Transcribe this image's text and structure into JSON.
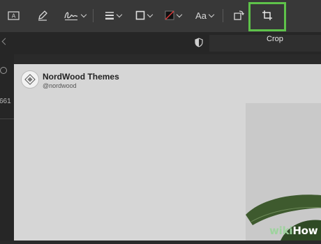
{
  "toolbar": {
    "tools": [
      {
        "icon": "text-box-icon"
      },
      {
        "icon": "pen-icon"
      },
      {
        "icon": "signature-icon"
      },
      {
        "icon": "line-style-icon"
      },
      {
        "icon": "border-color-icon"
      },
      {
        "icon": "fill-color-icon"
      },
      {
        "icon": "text-style-icon",
        "label": "Aa"
      },
      {
        "icon": "rotate-icon"
      },
      {
        "icon": "crop-icon"
      }
    ],
    "crop_tooltip": "Crop",
    "highlight_color": "#5ec24a"
  },
  "sidebar": {
    "partial_count": "661"
  },
  "post": {
    "author_name": "NordWood Themes",
    "author_handle": "@nordwood"
  },
  "watermark": {
    "brand_a": "wiki",
    "brand_b": "How"
  }
}
